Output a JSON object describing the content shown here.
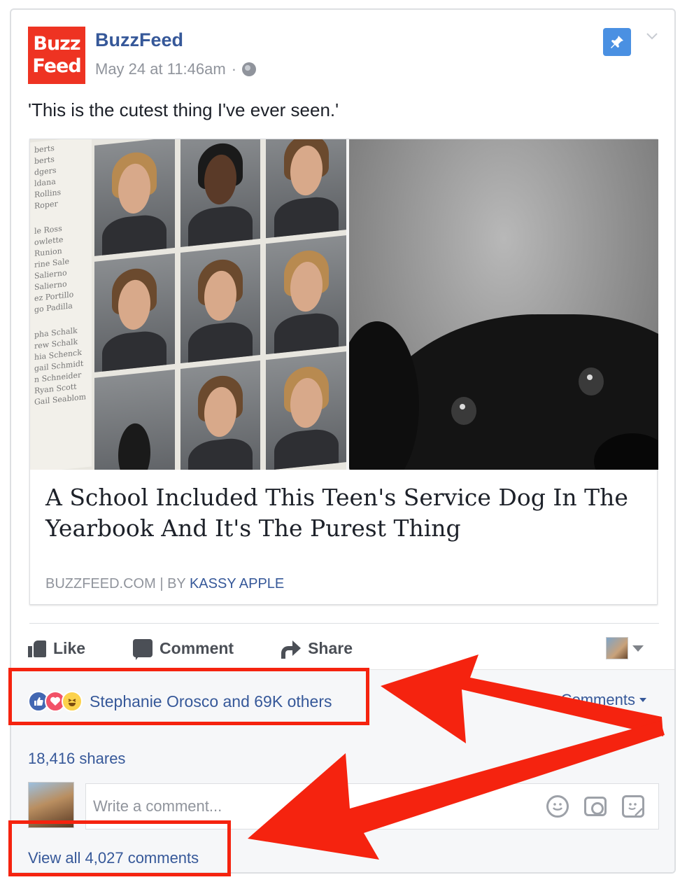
{
  "post": {
    "logo_line1": "Buzz",
    "logo_line2": "Feed",
    "page_name": "BuzzFeed",
    "timestamp": "May 24 at 11:46am",
    "separator": "·",
    "text": "'This is the cutest thing I've ever seen.'"
  },
  "yearbook_names": [
    "berts",
    "berts",
    "dgers",
    "ldana",
    "Rollins",
    "Roper",
    "le Ross",
    "owlette",
    "Runion",
    "rine Sale",
    "Salierno",
    "Salierno",
    "ez Portillo",
    "go Padilla",
    "pha Schalk",
    "rew Schalk",
    "hia Schenck",
    "gail Schmidt",
    "n Schneider",
    "Ryan Scott",
    "Gail Seablom"
  ],
  "link": {
    "title": "A School Included This Teen's Service Dog In The Yearbook And It's The Purest Thing",
    "source": "BUZZFEED.COM",
    "separator": " | ",
    "by": "BY ",
    "author": "KASSY APPLE"
  },
  "actions": {
    "like": "Like",
    "comment": "Comment",
    "share": "Share"
  },
  "feedback": {
    "reaction_text": "Stephanie Orosco and 69K others",
    "top_comments": "Top Comments",
    "shares": "18,416 shares",
    "comment_placeholder": "Write a comment...",
    "view_all": "View all 4,027 comments"
  },
  "icons": {
    "globe": "globe-icon",
    "pin": "pin-icon",
    "like": "thumbs-up-icon",
    "comment": "speech-bubble-icon",
    "share": "share-arrow-icon",
    "emoji": "smiley-icon",
    "camera": "camera-icon",
    "sticker": "sticker-icon"
  },
  "colors": {
    "brand_red": "#ee3322",
    "link_blue": "#365899",
    "annotation_red": "#f5230f",
    "pin_blue": "#4a90e2"
  }
}
